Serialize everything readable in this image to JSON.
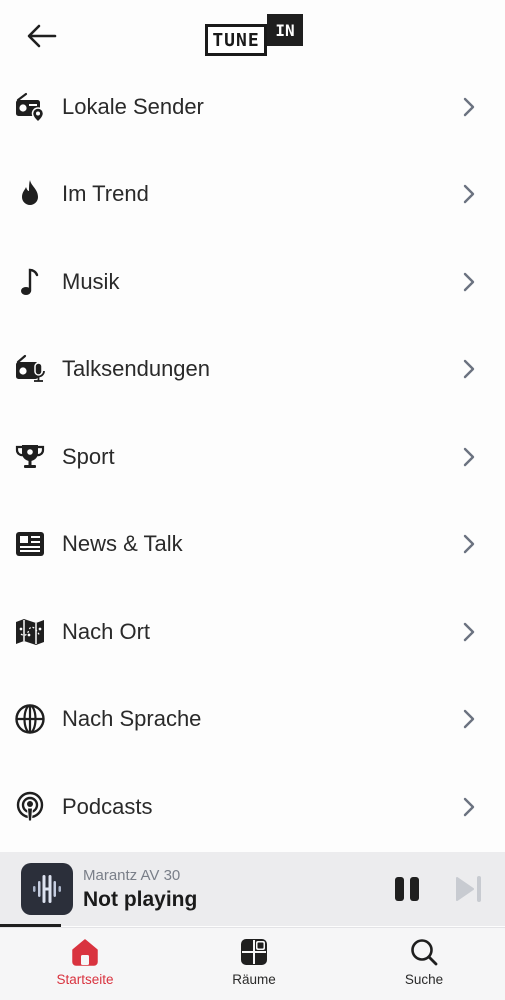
{
  "header": {
    "back_icon": "arrow-left-icon",
    "logo": {
      "left": "TUNE",
      "right": "IN"
    }
  },
  "menu": [
    {
      "label": "Lokale Sender",
      "icon": "radio-location-icon"
    },
    {
      "label": "Im Trend",
      "icon": "flame-icon"
    },
    {
      "label": "Musik",
      "icon": "music-note-icon"
    },
    {
      "label": "Talksendungen",
      "icon": "radio-microphone-icon"
    },
    {
      "label": "Sport",
      "icon": "trophy-icon"
    },
    {
      "label": "News & Talk",
      "icon": "newspaper-icon"
    },
    {
      "label": "Nach Ort",
      "icon": "map-icon"
    },
    {
      "label": "Nach Sprache",
      "icon": "globe-icon"
    },
    {
      "label": "Podcasts",
      "icon": "podcast-icon"
    }
  ],
  "player": {
    "device": "Marantz AV 30",
    "status": "Not playing",
    "pause_icon": "pause-icon",
    "next_icon": "skip-next-icon"
  },
  "tabs": [
    {
      "label": "Startseite",
      "icon": "home-icon",
      "active": true
    },
    {
      "label": "Räume",
      "icon": "grid-icon",
      "active": false
    },
    {
      "label": "Suche",
      "icon": "search-icon",
      "active": false
    }
  ],
  "colors": {
    "accent": "#d9333f",
    "text": "#2a2a2a",
    "player_bg": "#ececee",
    "chevron": "#6b7280"
  }
}
